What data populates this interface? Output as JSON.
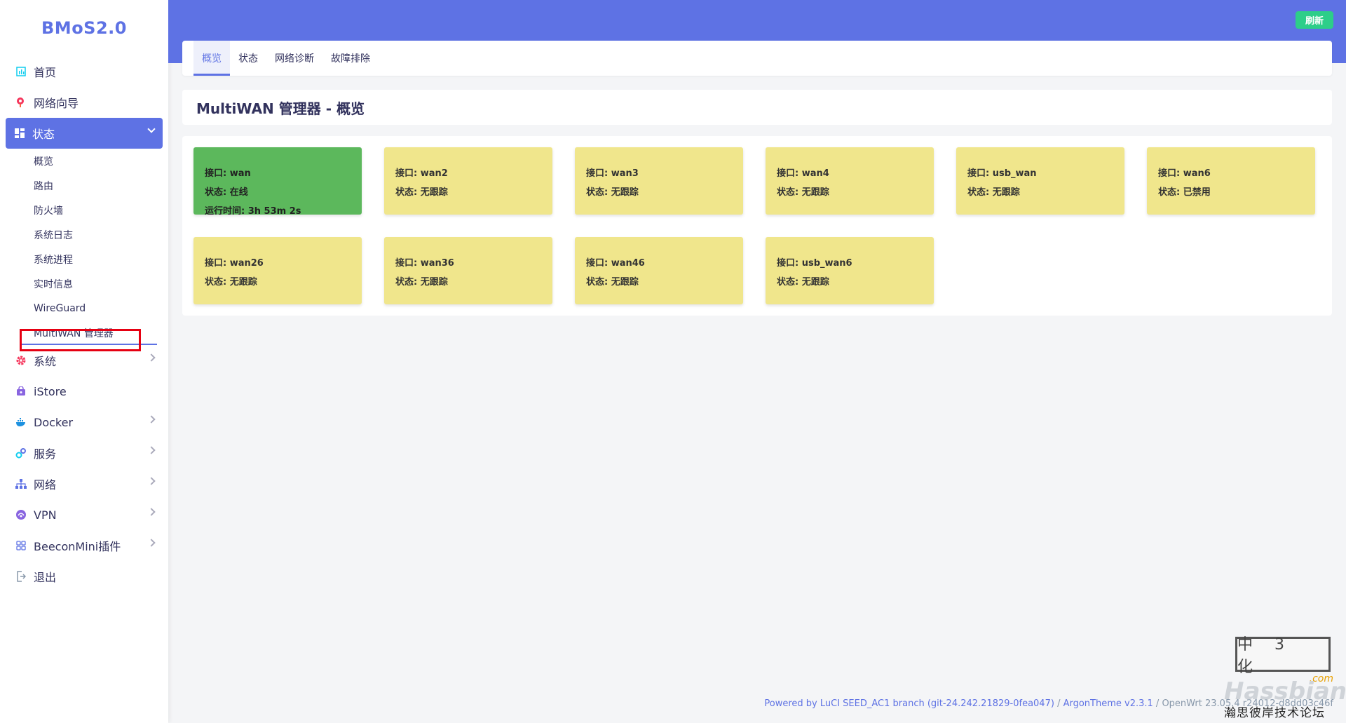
{
  "brand": "BMoS2.0",
  "header": {
    "refresh_label": "刷新"
  },
  "sidebar": {
    "items": [
      {
        "label": "首页",
        "icon": "dashboard-icon"
      },
      {
        "label": "网络向导",
        "icon": "wizard-icon"
      },
      {
        "label": "状态",
        "icon": "status-grid-icon",
        "expanded": true
      },
      {
        "label": "系统",
        "icon": "gear-icon"
      },
      {
        "label": "iStore",
        "icon": "store-icon"
      },
      {
        "label": "Docker",
        "icon": "docker-icon"
      },
      {
        "label": "服务",
        "icon": "services-icon"
      },
      {
        "label": "网络",
        "icon": "network-icon"
      },
      {
        "label": "VPN",
        "icon": "vpn-icon"
      },
      {
        "label": "BeeconMini插件",
        "icon": "plugins-icon"
      },
      {
        "label": "退出",
        "icon": "logout-icon"
      }
    ],
    "status_sub": [
      "概览",
      "路由",
      "防火墙",
      "系统日志",
      "系统进程",
      "实时信息",
      "WireGuard",
      "MultiWAN 管理器"
    ]
  },
  "tabs": [
    "概览",
    "状态",
    "网络诊断",
    "故障排除"
  ],
  "page_title": "MultiWAN 管理器 - 概览",
  "interfaces": [
    {
      "iface": "接口: wan",
      "status": "状态: 在线",
      "uptime": "运行时间: 3h 53m 2s",
      "state": "online"
    },
    {
      "iface": "接口: wan2",
      "status": "状态: 无跟踪",
      "state": "notrack"
    },
    {
      "iface": "接口: wan3",
      "status": "状态: 无跟踪",
      "state": "notrack"
    },
    {
      "iface": "接口: wan4",
      "status": "状态: 无跟踪",
      "state": "notrack"
    },
    {
      "iface": "接口: usb_wan",
      "status": "状态: 无跟踪",
      "state": "notrack"
    },
    {
      "iface": "接口: wan6",
      "status": "状态: 已禁用",
      "state": "disabled"
    },
    {
      "iface": "接口: wan26",
      "status": "状态: 无跟踪",
      "state": "notrack"
    },
    {
      "iface": "接口: wan36",
      "status": "状态: 无跟踪",
      "state": "notrack"
    },
    {
      "iface": "接口: wan46",
      "status": "状态: 无跟踪",
      "state": "notrack"
    },
    {
      "iface": "接口: usb_wan6",
      "status": "状态: 无跟踪",
      "state": "notrack"
    }
  ],
  "footer": {
    "powered": "Powered by LuCI SEED_AC1 branch (git-24.242.21829-0fea047)",
    "sep": " / ",
    "theme": "ArgonTheme v2.3.1",
    "openwrt": " / OpenWrt 23.05.4 r24012-d8dd03c46f"
  },
  "watermark": {
    "box": "中 3 化",
    "com": ".com",
    "main": "Hassbian",
    "sub": "瀚思彼岸技术论坛"
  },
  "colors": {
    "accent": "#5e72e4",
    "online": "#5cb85c",
    "notrack": "#f0e68c",
    "refresh": "#2dce89",
    "highlight": "#e60012"
  }
}
